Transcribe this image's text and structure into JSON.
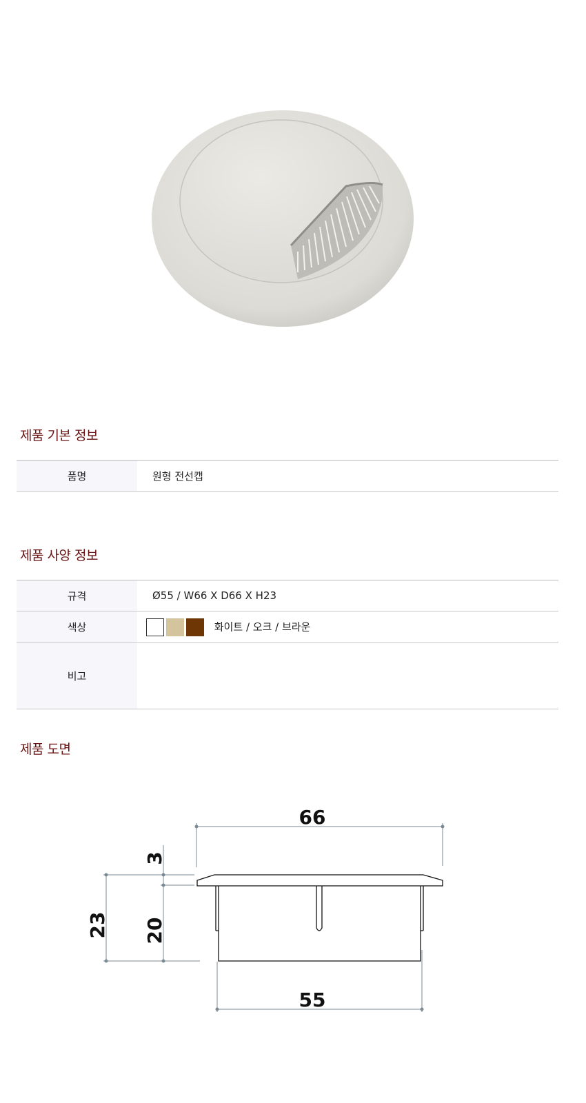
{
  "sections": {
    "basic_info_title": "제품 기본 정보",
    "spec_info_title": "제품 사양 정보",
    "drawing_title": "제품 도면"
  },
  "basic_info": {
    "rows": [
      {
        "label": "품명",
        "value": "원형 전선캡"
      }
    ]
  },
  "spec_info": {
    "spec_label": "규격",
    "spec_value": "Ø55 / W66 X D66 X H23",
    "color_label": "색상",
    "color_value": "화이트 / 오크 / 브라운",
    "swatches": [
      {
        "name": "화이트",
        "color": "#ffffff"
      },
      {
        "name": "오크",
        "color": "#d4c49d"
      },
      {
        "name": "브라운",
        "color": "#6e3505"
      }
    ],
    "note_label": "비고",
    "note_value": ""
  },
  "drawing": {
    "dim_top_width": "66",
    "dim_bottom_width": "55",
    "dim_lip_height": "3",
    "dim_body_height": "20",
    "dim_total_height": "23"
  }
}
